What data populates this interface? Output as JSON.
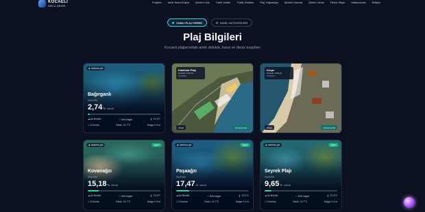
{
  "brand": {
    "line1": "KOCAELİ",
    "line2": "AKILLI ŞEHİR"
  },
  "nav": [
    "Projeler",
    "Akıllı Nasıl Erişim",
    "Şehrimi İzle",
    "Canlı Veriler",
    "Trafik Haritası",
    "Plaj Yoğunluğu",
    "Şehrini Hazırla",
    "Şehrin Verisi",
    "Fikrini Söyle",
    "Hakkımızda",
    "İletişim"
  ],
  "tabs": {
    "active": "CANLI PLAJ VERİSİ",
    "inactive": "SAHİL AKTİVİTELERİ"
  },
  "page": {
    "title": "Plaj Bilgileri",
    "subtitle": "Kocaeli plajlarındaki anlık doluluk, hava ve deniz koşulları"
  },
  "cards": [
    {
      "name": "Bağırganlı",
      "loc": "KANDIRA",
      "pill": "harita'da gör",
      "occ": "2,74",
      "occ_unit": "%",
      "occ_label": "doluluk",
      "occ_fraction": 0.0274,
      "weather": "Az Bulutlu",
      "wind": "N/A rüzgar",
      "temp": "27,4°C",
      "wind2": "12 km/sa",
      "sea": "Deniz: 21,7°C",
      "wave": "Dalga: 0,4 m",
      "color": "#2a6f8a"
    },
    {
      "name": "Kovanağzı",
      "loc": "KANDIRA",
      "pill": "harita'da gör",
      "badge": "Uygun",
      "occ": "15,18",
      "occ_unit": "%",
      "occ_label": "doluluk",
      "occ_fraction": 0.1518,
      "weather": "Az Bulutlu",
      "wind": "N/A rüzgar",
      "temp": "27,4°C",
      "wind2": "12 km/sa",
      "sea": "Deniz: 21,7°C",
      "wave": "Dalga: 0,4 m",
      "color": "#2e6a63"
    },
    {
      "name": "Paşaağzı",
      "loc": "KANDIRA",
      "pill": "harita'da gör",
      "badge": "Uygun",
      "occ": "17,47",
      "occ_unit": "%",
      "occ_label": "doluluk",
      "occ_fraction": 0.1747,
      "weather": "Az Bulutlu",
      "wind": "N/A rüzgar",
      "temp": "27,4°C",
      "wind2": "12 km/sa",
      "sea": "Deniz: 21,7°C",
      "wave": "Dalga: 0,4 m",
      "color": "#1f5f83"
    },
    {
      "name": "Seyrek Plajı",
      "loc": "KANDIRA",
      "pill": "harita'da gör",
      "badge": "Uygun",
      "occ": "9,65",
      "occ_unit": "%",
      "occ_label": "doluluk",
      "occ_fraction": 0.0965,
      "weather": "Az Bulutlu",
      "wind": "N/A rüzgar",
      "temp": "27,4°C",
      "wind2": "12 km/sa",
      "sea": "Deniz: 21,7°C",
      "wave": "Dalga: 0,4 m",
      "color": "#276b73"
    }
  ],
  "maps": [
    {
      "name": "Kadırdar Plajı",
      "occ": "Doluluk: %13,79",
      "loc": "KANDIRA",
      "back": "Geri",
      "zoom": "Konuma Git"
    },
    {
      "name": "Kerpe",
      "occ": "Doluluk: %18,43",
      "loc": "KANDIRA",
      "back": "Geri",
      "zoom": "Konuma Git"
    }
  ]
}
